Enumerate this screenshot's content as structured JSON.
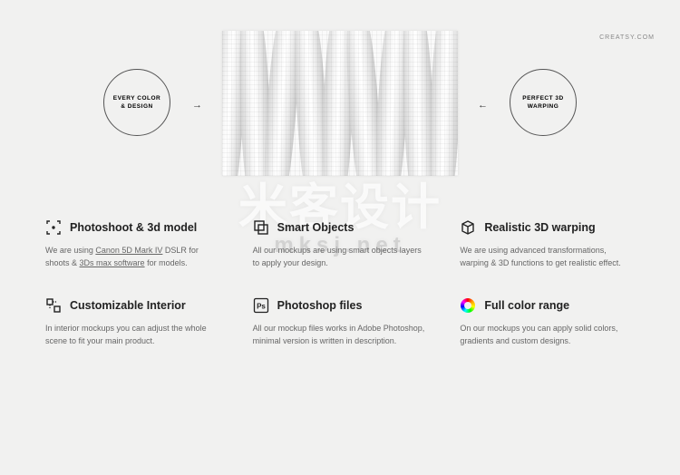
{
  "brand": "CREATSY.COM",
  "hero": {
    "left_circle": "EVERY COLOR\n& DESIGN",
    "right_circle": "PERFECT 3D\nWARPING"
  },
  "watermark": {
    "main": "米客设计",
    "sub": "mksj.net"
  },
  "features": [
    {
      "icon": "focus-icon",
      "title": "Photoshoot & 3d model",
      "text_parts": [
        "We are using ",
        "Canon 5D Mark IV",
        " DSLR for shoots & ",
        "3Ds max software",
        " for models."
      ],
      "underlined": [
        1,
        3
      ]
    },
    {
      "icon": "smart-objects-icon",
      "title": "Smart Objects",
      "text_parts": [
        "All our mockups are using smart objects layers to apply your design."
      ],
      "underlined": []
    },
    {
      "icon": "cube-icon",
      "title": "Realistic 3D warping",
      "text_parts": [
        "We are using advanced transformations, warping & 3D functions to get realistic effect."
      ],
      "underlined": []
    },
    {
      "icon": "interior-icon",
      "title": "Customizable Interior",
      "text_parts": [
        "In interior mockups you can adjust the whole scene to fit your main product."
      ],
      "underlined": []
    },
    {
      "icon": "photoshop-icon",
      "title": "Photoshop files",
      "text_parts": [
        "All our mockup files works in Adobe Photoshop, minimal version is written in description."
      ],
      "underlined": []
    },
    {
      "icon": "color-range-icon",
      "title": "Full color range",
      "text_parts": [
        "On our mockups you can apply solid colors, gradients and custom designs."
      ],
      "underlined": []
    }
  ]
}
